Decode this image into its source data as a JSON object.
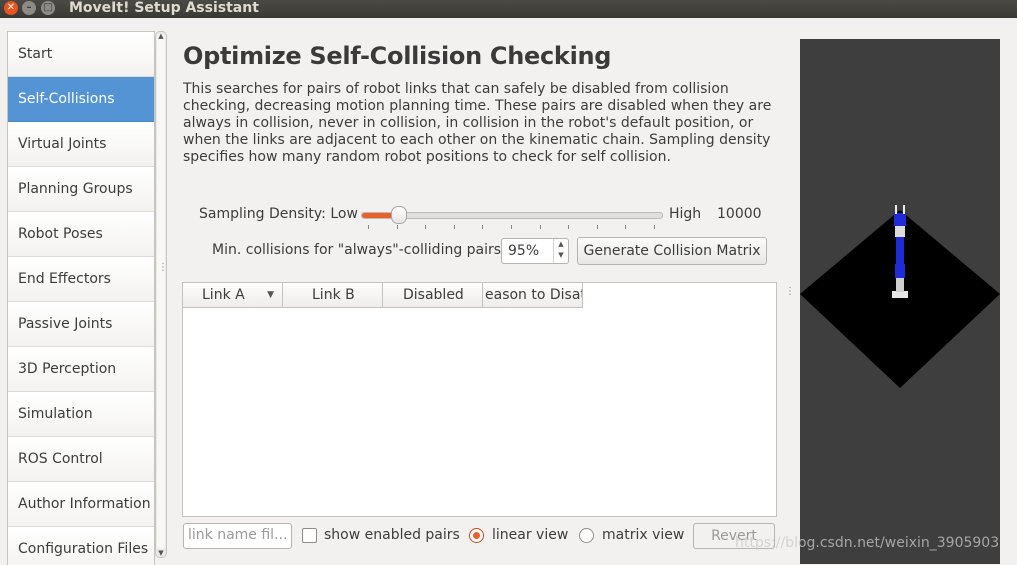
{
  "window": {
    "title": "MoveIt! Setup Assistant"
  },
  "sidebar": {
    "items": [
      {
        "label": "Start"
      },
      {
        "label": "Self-Collisions",
        "active": true
      },
      {
        "label": "Virtual Joints"
      },
      {
        "label": "Planning Groups"
      },
      {
        "label": "Robot Poses"
      },
      {
        "label": "End Effectors"
      },
      {
        "label": "Passive Joints"
      },
      {
        "label": "3D Perception"
      },
      {
        "label": "Simulation"
      },
      {
        "label": "ROS Control"
      },
      {
        "label": "Author Information"
      },
      {
        "label": "Configuration Files"
      }
    ]
  },
  "main": {
    "title": "Optimize Self-Collision Checking",
    "description": "This searches for pairs of robot links that can safely be disabled from collision checking, decreasing motion planning time. These pairs are disabled when they are always in collision, never in collision, in collision in the robot's default position, or when the links are adjacent to each other on the kinematic chain. Sampling density specifies how many random robot positions to check for self collision.",
    "density": {
      "label": "Sampling Density: Low",
      "high_label": "High",
      "value": "10000",
      "slider_level": 0.1,
      "accent_color": "#e9602b"
    },
    "min_collisions": {
      "label": "Min. collisions for \"always\"-colliding pairs:",
      "value": "95%"
    },
    "generate_button": "Generate Collision Matrix",
    "table": {
      "columns": [
        "Link A",
        "Link B",
        "Disabled",
        "eason to Disat"
      ]
    },
    "footer": {
      "filter_placeholder": "link name fil...",
      "show_enabled_label": "show enabled pairs",
      "linear_view_label": "linear view",
      "matrix_view_label": "matrix view",
      "revert_label": "Revert",
      "selected_view": "linear"
    }
  },
  "watermark": "https://blog.csdn.net/weixin_3905903",
  "colors": {
    "active_nav": "#5594d4",
    "accent": "#e9602b",
    "robot_blue": "#1f2bd6"
  }
}
